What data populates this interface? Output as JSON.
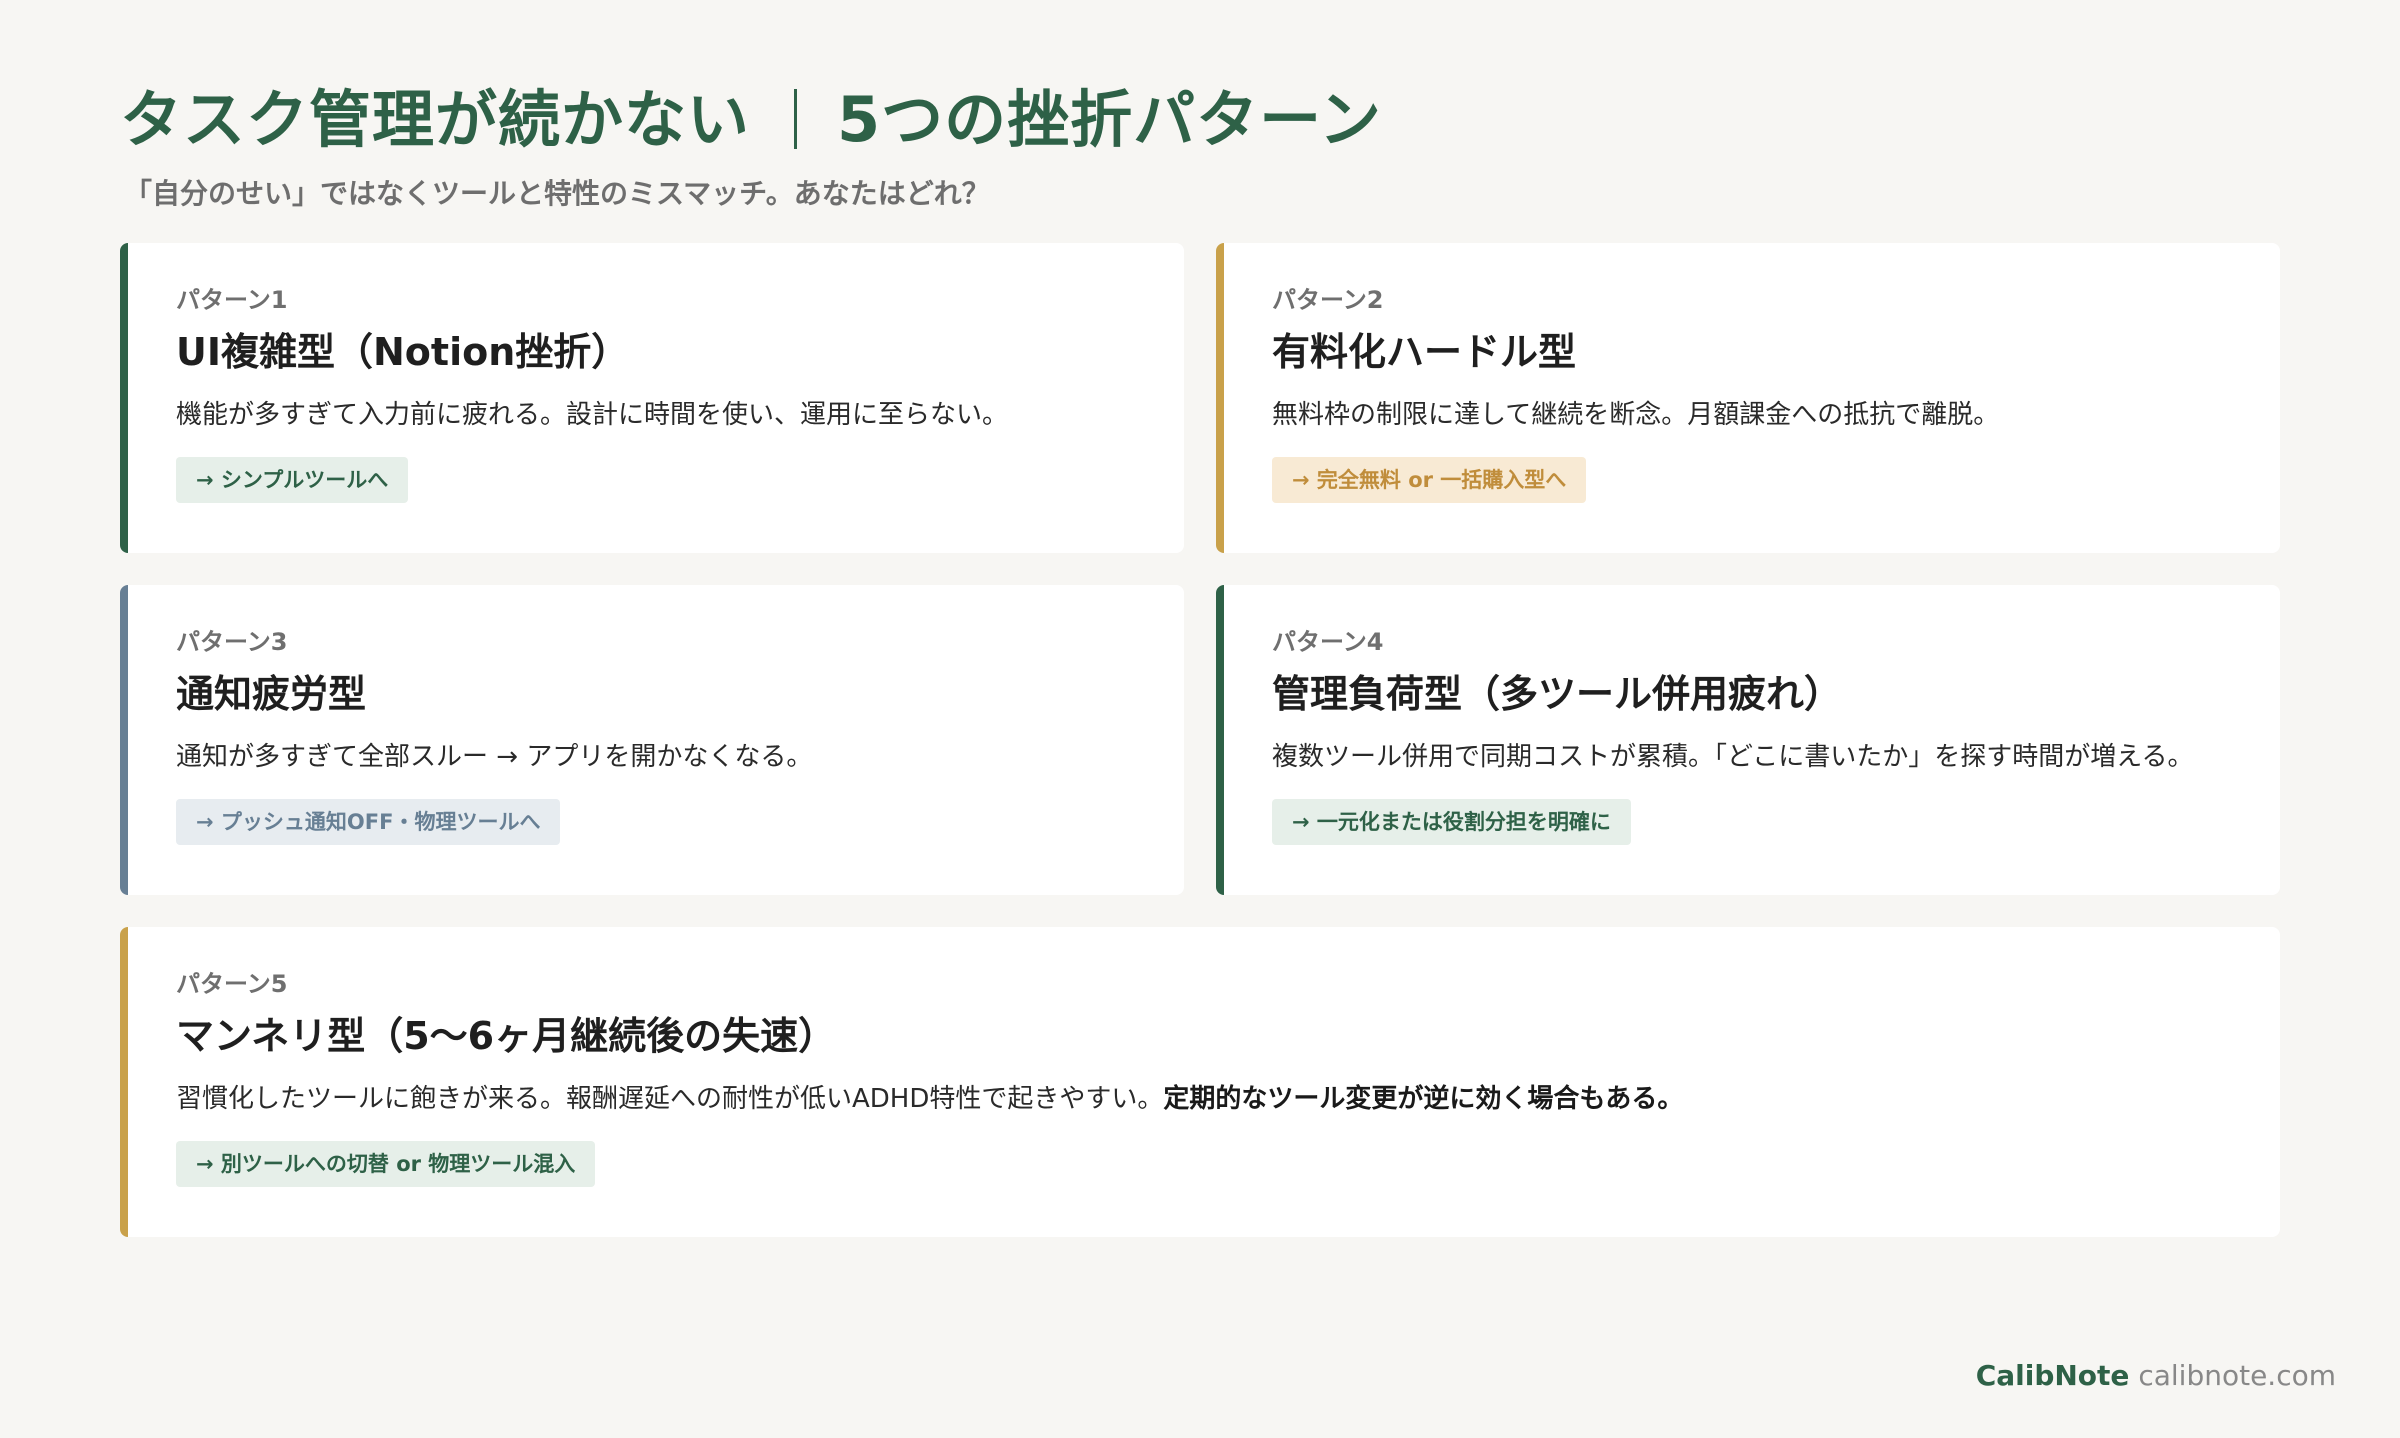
{
  "header": {
    "title_left": "タスク管理が続かない",
    "title_right": "5つの挫折パターン",
    "subtitle": "「自分のせい」ではなくツールと特性のミスマッチ。あなたはどれ？"
  },
  "cards": [
    {
      "label": "パターン1",
      "title": "UI複雑型（Notion挫折）",
      "desc": "機能が多すぎて入力前に疲れる。設計に時間を使い、運用に至らない。",
      "tag": "→ シンプルツールへ",
      "accent": "#2e6147"
    },
    {
      "label": "パターン2",
      "title": "有料化ハードル型",
      "desc": "無料枠の制限に達して継続を断念。月額課金への抵抗で離脱。",
      "tag": "→ 完全無料 or 一括購入型へ",
      "accent": "#c9a14a"
    },
    {
      "label": "パターン3",
      "title": "通知疲労型",
      "desc": "通知が多すぎて全部スルー → アプリを開かなくなる。",
      "tag": "→ プッシュ通知OFF・物理ツールへ",
      "accent": "#677f94"
    },
    {
      "label": "パターン4",
      "title": "管理負荷型（多ツール併用疲れ）",
      "desc": "複数ツール併用で同期コストが累積。「どこに書いたか」を探す時間が増える。",
      "tag": "→ 一元化または役割分担を明確に",
      "accent": "#2e6147"
    },
    {
      "label": "パターン5",
      "title": "マンネリ型（5〜6ヶ月継続後の失速）",
      "desc": "習慣化したツールに飽きが来る。報酬遅延への耐性が低いADHD特性で起きやすい。",
      "desc_bold": "定期的なツール変更が逆に効く場合もある。",
      "tag": "→ 別ツールへの切替 or 物理ツール混入",
      "accent": "#c9a14a"
    }
  ],
  "footer": {
    "brand": "CalibNote",
    "url": "calibnote.com"
  }
}
